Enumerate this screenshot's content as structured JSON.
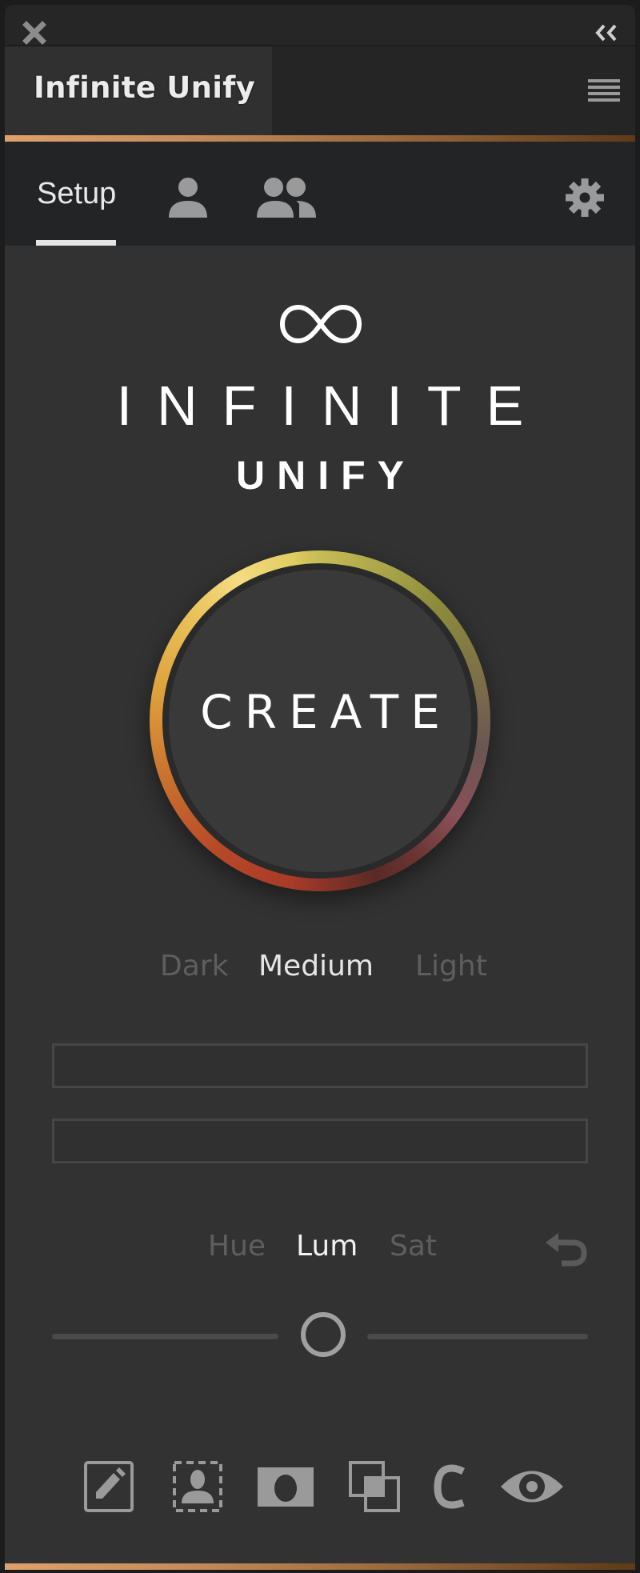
{
  "window": {
    "close_icon": "close-icon",
    "collapse_icon": "double-chevron-left-icon"
  },
  "panel_tab": {
    "title": "Infinite Unify",
    "menu_icon": "hamburger-menu-icon"
  },
  "nav": {
    "tabs": [
      {
        "label": "Setup",
        "active": true
      },
      {
        "icon": "person-icon",
        "active": false
      },
      {
        "icon": "group-icon",
        "active": false
      }
    ],
    "settings_icon": "gear-icon"
  },
  "logo": {
    "icon": "infinity-icon",
    "line1": "INFINITE",
    "line2": "UNIFY"
  },
  "create_button": {
    "label": "CREATE"
  },
  "tone": {
    "options": [
      "Dark",
      "Medium",
      "Light"
    ],
    "selected": "Medium"
  },
  "fields": [
    {
      "value": ""
    },
    {
      "value": ""
    }
  ],
  "adjust": {
    "options": [
      "Hue",
      "Lum",
      "Sat"
    ],
    "selected": "Lum",
    "undo_icon": "undo-icon",
    "slider_value_percent": 50
  },
  "toolbar": {
    "tools": [
      {
        "icon": "edit-pencil-icon"
      },
      {
        "icon": "select-subject-icon"
      },
      {
        "icon": "mask-icon"
      },
      {
        "icon": "overlap-layers-icon"
      },
      {
        "icon": "c-letter-icon",
        "label": "C"
      },
      {
        "icon": "eye-icon"
      }
    ]
  },
  "colors": {
    "accent_copper_start": "#e0a06c",
    "accent_copper_end": "#5e3a18",
    "background": "#323232",
    "active_text": "#e6e6e6",
    "inactive_text": "#5e5e5e",
    "icon_gray": "#9a9a9a"
  }
}
